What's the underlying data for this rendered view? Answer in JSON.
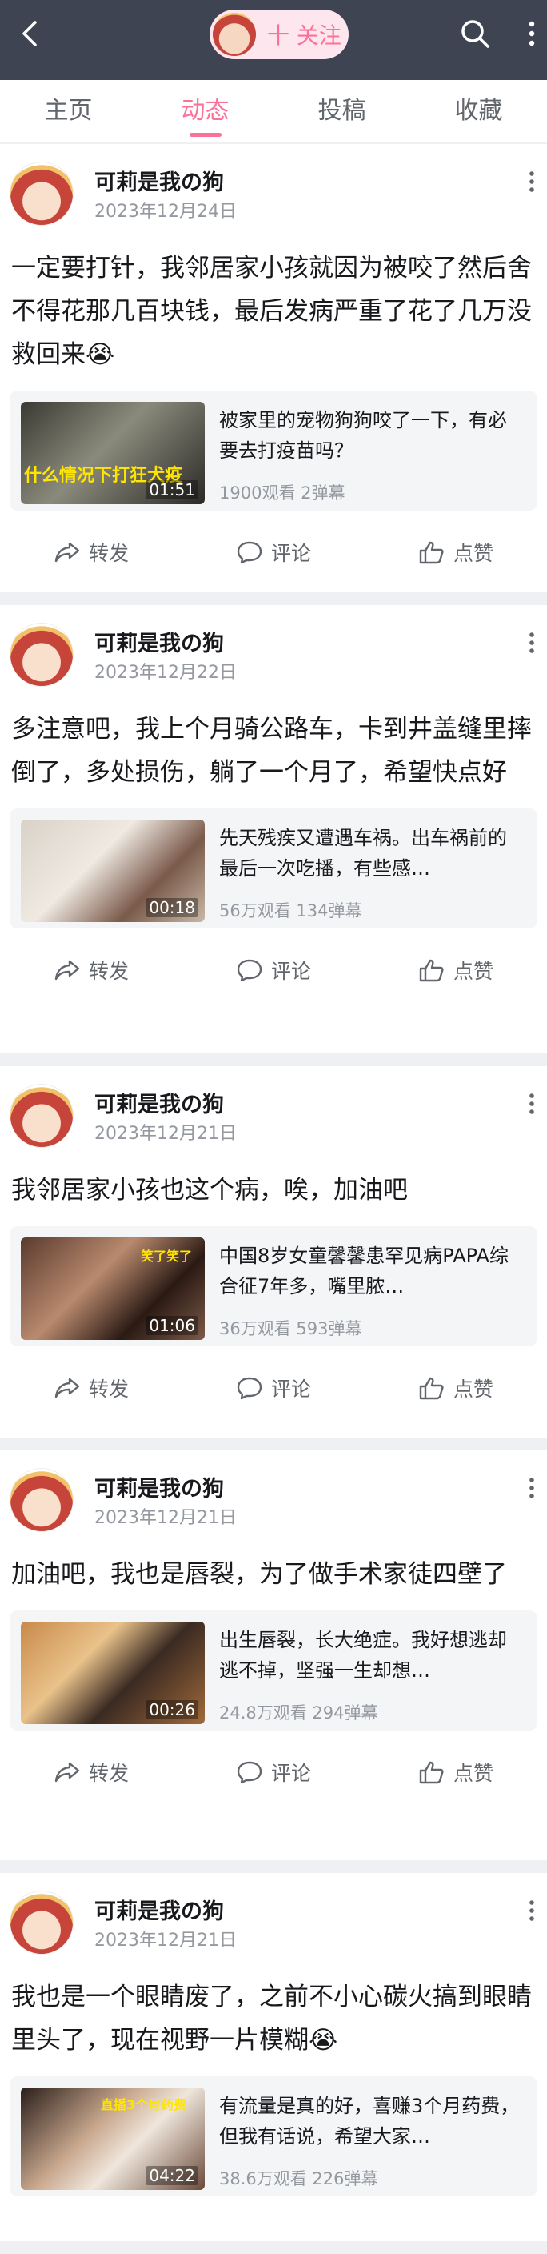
{
  "header": {
    "back_icon": "back-arrow-icon",
    "follow_label": "十 关注",
    "search_icon": "search-icon",
    "more_icon": "more-vertical-icon",
    "background_color": "#3f4453",
    "accent_color": "#fb7299"
  },
  "tabs": [
    {
      "label": "主页",
      "active": false
    },
    {
      "label": "动态",
      "active": true
    },
    {
      "label": "投稿",
      "active": false
    },
    {
      "label": "收藏",
      "active": false
    }
  ],
  "posts": [
    {
      "name": "可莉是我の狗",
      "date": "2023年12月24日",
      "text": "一定要打针，我邻居家小孩就因为被咬了然后舍不得花那几百块钱，最后发病严重了花了几万没救回来😭",
      "video": {
        "title": "被家里的宠物狗狗咬了一下，有必要去打疫苗吗？",
        "duration": "01:51",
        "stats": "1900观看  2弹幕",
        "thumb_text": "什么情况下打狂犬疫"
      },
      "actions": {
        "share": "转发",
        "comment": "评论",
        "like": "点赞"
      }
    },
    {
      "name": "可莉是我の狗",
      "date": "2023年12月22日",
      "text": "多注意吧，我上个月骑公路车，卡到井盖缝里摔倒了，多处损伤，躺了一个月了，希望快点好",
      "video": {
        "title": "先天残疾又遭遇车祸。出车祸前的最后一次吃播，有些感…",
        "duration": "00:18",
        "stats": "56万观看  134弹幕",
        "thumb_text": ""
      },
      "actions": {
        "share": "转发",
        "comment": "评论",
        "like": "点赞"
      }
    },
    {
      "name": "可莉是我の狗",
      "date": "2023年12月21日",
      "text": "我邻居家小孩也这个病，唉，加油吧",
      "video": {
        "title": "中国8岁女童馨馨患罕见病PAPA综合征7年多，嘴里脓…",
        "duration": "01:06",
        "stats": "36万观看  593弹幕",
        "thumb_text": "笑了笑了"
      },
      "actions": {
        "share": "转发",
        "comment": "评论",
        "like": "点赞"
      }
    },
    {
      "name": "可莉是我の狗",
      "date": "2023年12月21日",
      "text": "加油吧，我也是唇裂，为了做手术家徒四壁了",
      "video": {
        "title": "出生唇裂，长大绝症。我好想逃却逃不掉，坚强一生却想…",
        "duration": "00:26",
        "stats": "24.8万观看  294弹幕",
        "thumb_text": ""
      },
      "actions": {
        "share": "转发",
        "comment": "评论",
        "like": "点赞"
      }
    },
    {
      "name": "可莉是我の狗",
      "date": "2023年12月21日",
      "text": "我也是一个眼睛废了，之前不小心碳火搞到眼睛里头了，现在视野一片模糊😭",
      "video": {
        "title": "有流量是真的好，喜赚3个月药费，但我有话说，希望大家…",
        "duration": "04:22",
        "stats": "38.6万观看  226弹幕",
        "thumb_text": "直播3个月药费"
      },
      "actions": {
        "share": "转发",
        "comment": "评论",
        "like": "点赞"
      }
    }
  ]
}
